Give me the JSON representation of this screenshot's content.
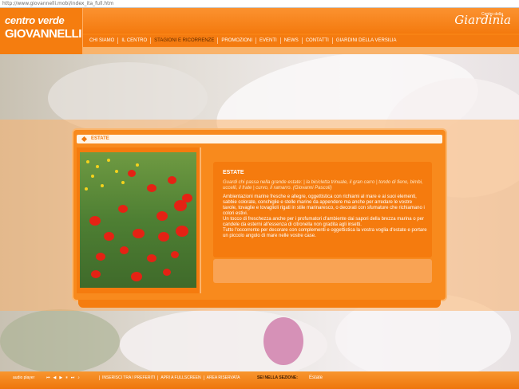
{
  "browser": {
    "url": "http://www.giovannelli.mobi/index_ita_full.htm"
  },
  "header": {
    "logo_line1": "centro verde",
    "logo_line2": "GIOVANNELLI",
    "brand": "Giardinia",
    "brand_small": "Centro della"
  },
  "nav": [
    {
      "label": "CHI SIAMO"
    },
    {
      "label": "IL CENTRO"
    },
    {
      "label": "STAGIONI E RICORRENZE",
      "active": true
    },
    {
      "label": "PROMOZIONI"
    },
    {
      "label": "EVENTI"
    },
    {
      "label": "NEWS"
    },
    {
      "label": "CONTATTI"
    },
    {
      "label": "GIARDINI DELLA VERSILIA"
    }
  ],
  "panel": {
    "title": "ESTATE",
    "season_title": "ESTATE",
    "quote": "Guardi chi passa nella grande estate: | la bicicletta trinuale, il gran carro | tondo di fieno, bimbi, uccelli, il frate | curvo, il ramarro. (Giovanni Pascoli)",
    "paragraph1": "Ambientazioni marine fresche e allegre, oggettistica con richiami al mare e ai suoi elementi, sabbie colorate, conchiglie e stelle marine da appendere ma anche per arredare le vostre tavole, tovaglie e tovaglioli rigati in stile marinaresco, o decorati con sfumature che richiamano i colori estivi.",
    "paragraph2": "Un tocco di freschezza anche per i profumatori d'ambiente dai sapori della brezza marina o per candele da esterni all'essenza di citronella non gradita agli insetti.",
    "paragraph3": "Tutto l'occorrente per decorare con complementi e oggettistica la vostra voglia d'estate e portare un piccolo angolo di mare nelle vostre case."
  },
  "footer": {
    "audio_label": "audio player",
    "controls": [
      "⏮",
      "◀",
      "▶",
      "⏸",
      "⏭",
      "♪"
    ],
    "links": [
      {
        "label": "INSERISCI TRA I PREFERITI"
      },
      {
        "label": "APRI A FULLSCREEN"
      },
      {
        "label": "AREA RISERVATA"
      }
    ],
    "section_label": "SEI NELLA SEZIONE:",
    "section_value": "Estate"
  },
  "colors": {
    "orange": "#f57b0e",
    "light_orange": "#f9b36b",
    "text_dark": "#5a2a00"
  }
}
